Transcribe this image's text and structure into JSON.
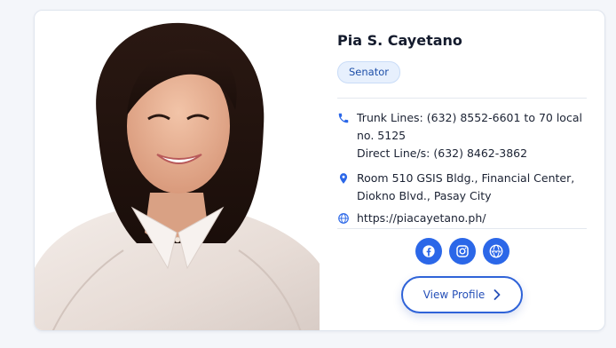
{
  "profile": {
    "name": "Pia S. Cayetano",
    "position": "Senator",
    "photo_alt": "Pia S. Cayetano portrait"
  },
  "contact": {
    "phone_lines": [
      "Trunk Lines: (632) 8552-6601 to 70 local",
      "no. 5125",
      "Direct Line/s: (632) 8462-3862"
    ],
    "address_lines": [
      "Room 510 GSIS Bldg., Financial Center,",
      "Diokno Blvd., Pasay City"
    ],
    "website": "https://piacayetano.ph/"
  },
  "socials": [
    {
      "icon": "facebook-icon"
    },
    {
      "icon": "instagram-icon"
    },
    {
      "icon": "website-globe-icon"
    }
  ],
  "actions": {
    "view_profile_label": "View Profile"
  },
  "colors": {
    "accent": "#2b67e8",
    "badge_bg": "#e7f0fd",
    "text": "#141b2d"
  }
}
